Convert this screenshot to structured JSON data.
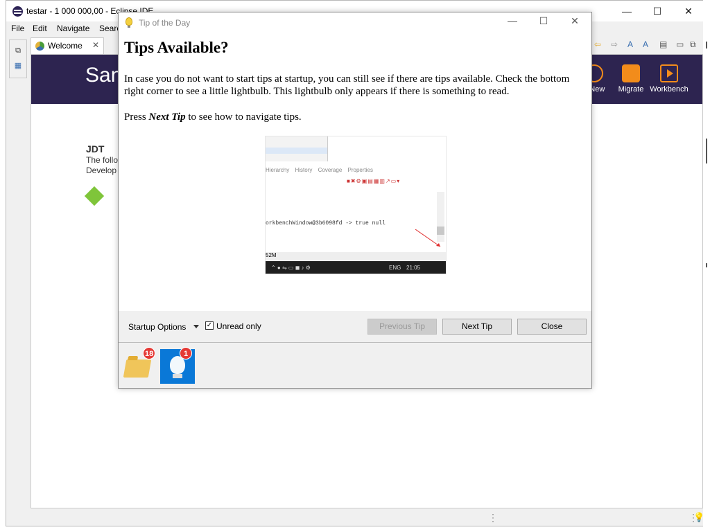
{
  "app": {
    "title": "testar - 1 000 000,00 - Eclipse IDE",
    "window_controls": [
      "—",
      "☐",
      "✕"
    ]
  },
  "menu": [
    "File",
    "Edit",
    "Navigate",
    "Searc"
  ],
  "editor": {
    "tab_label": "Welcome",
    "tab_close": "✕"
  },
  "welcome": {
    "banner_title": "San",
    "banner_buttons": [
      "s New",
      "Migrate",
      "Workbench"
    ],
    "jdt_heading": "JDT",
    "jdt_lines": [
      "The follo",
      "Develop"
    ]
  },
  "dialog": {
    "title": "Tip of the Day",
    "controls": [
      "—",
      "☐",
      "✕"
    ],
    "heading": "Tips Available?",
    "paragraph1": "In case you do not want to start tips at startup, you can still see if there are tips available. Check the bottom right corner to see a little lightbulb. This lightbulb only appears if there is something to read.",
    "paragraph2_prefix": "Press ",
    "paragraph2_emph": "Next Tip",
    "paragraph2_suffix": " to see how to navigate tips.",
    "tip_image": {
      "tabs": [
        "Hierarchy",
        "History",
        "Coverage",
        "Properties"
      ],
      "code_text": "orkbenchWindow@3b6098fd -> true null",
      "status_text": "52M",
      "taskbar_lang": "ENG",
      "taskbar_time": "21:05"
    },
    "footer": {
      "startup_options_label": "Startup Options",
      "unread_only_label": "Unread only",
      "unread_only_checked": true,
      "previous_tip_label": "Previous Tip",
      "next_tip_label": "Next Tip",
      "close_label": "Close"
    },
    "tip_providers": [
      {
        "icon": "folder-icon",
        "count": "18",
        "selected": false
      },
      {
        "icon": "lightbulb-icon",
        "count": "1",
        "selected": true
      }
    ]
  },
  "colors": {
    "banner_bg": "#2d2450",
    "accent_orange": "#f28c1b",
    "badge_red": "#e53935",
    "selection_blue": "#0a78d7"
  }
}
